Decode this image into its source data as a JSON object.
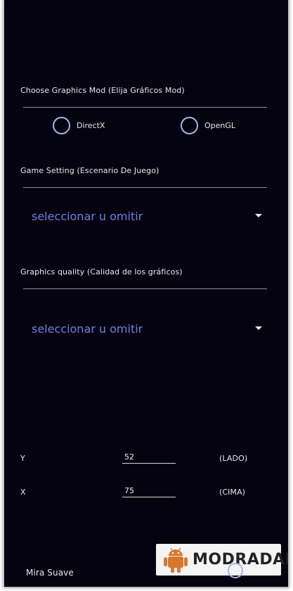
{
  "graphics_mod": {
    "title": "Choose Graphics Mod (Elija Gráficos Mod)",
    "options": [
      {
        "label": "DirectX",
        "selected": false
      },
      {
        "label": "OpenGL",
        "selected": false
      }
    ]
  },
  "game_setting": {
    "title": "Game Setting (Escenario De Juego)",
    "select_value": "seleccionar u omitir"
  },
  "graphics_quality": {
    "title": "Graphics quality (Calidad de los gráficos)",
    "select_value": "seleccionar u omitir"
  },
  "position": {
    "y_label": "Y",
    "y_value": "52",
    "y_suffix": "(LADO)",
    "x_label": "X",
    "x_value": "75",
    "x_suffix": "(CIMA)"
  },
  "smooth_aim": {
    "label": "Mira Suave"
  },
  "watermark": {
    "text": "MODRADAR"
  },
  "colors": {
    "background": "#04030f",
    "accent": "#6f7de8",
    "radio": "#aab5e8"
  }
}
